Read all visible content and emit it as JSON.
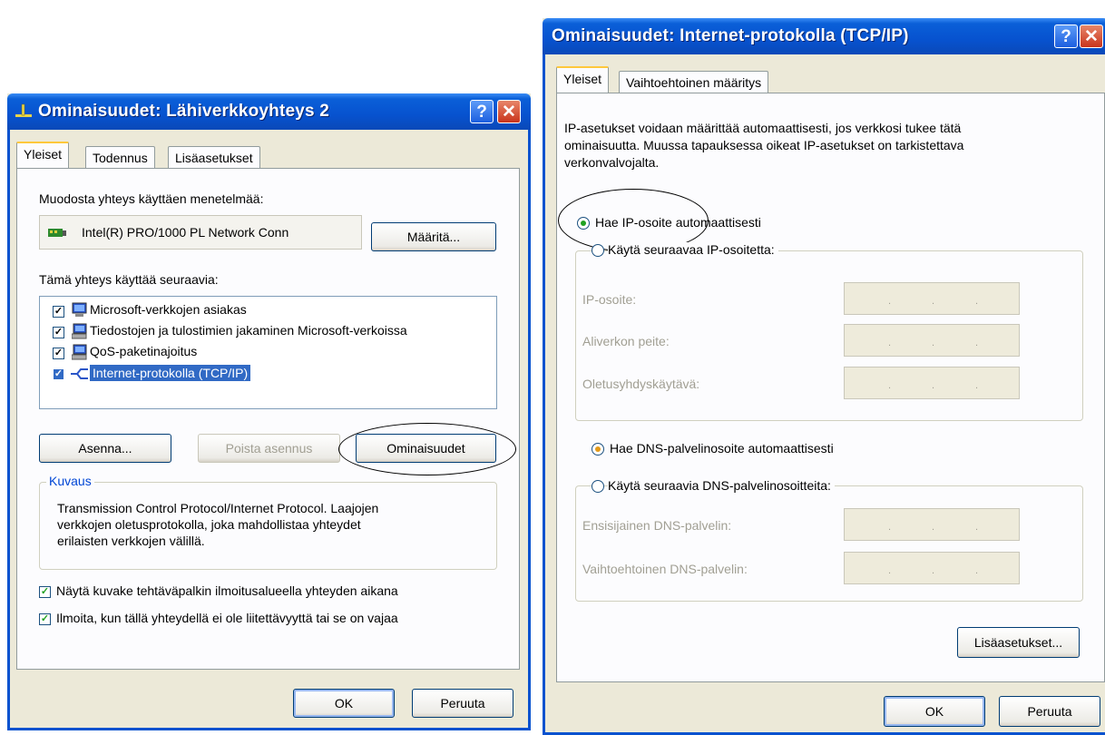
{
  "left_dialog": {
    "title": "Ominaisuudet: Lähiverkkoyhteys 2",
    "help_btn": "?",
    "close_btn": "✕",
    "tabs": [
      "Yleiset",
      "Todennus",
      "Lisäasetukset"
    ],
    "connect_using_label": "Muodosta yhteys käyttäen menetelmää:",
    "adapter_name": "Intel(R) PRO/1000 PL Network Conn",
    "configure_button": "Määritä...",
    "components_label": "Tämä yhteys käyttää seuraavia:",
    "components": [
      {
        "label": "Microsoft-verkkojen asiakas",
        "checked": true
      },
      {
        "label": "Tiedostojen ja tulostimien jakaminen Microsoft-verkoissa",
        "checked": true
      },
      {
        "label": "QoS-paketinajoitus",
        "checked": true
      },
      {
        "label": "Internet-protokolla (TCP/IP)",
        "checked": true,
        "selected": true
      }
    ],
    "install_button": "Asenna...",
    "uninstall_button": "Poista asennus",
    "properties_button": "Ominaisuudet",
    "description_group": "Kuvaus",
    "description_text": [
      "Transmission Control Protocol/Internet Protocol. Laajojen",
      "verkkojen oletusprotokolla, joka mahdollistaa yhteydet",
      "erilaisten verkkojen välillä."
    ],
    "show_icon_label": "Näytä kuvake tehtäväpalkin ilmoitusalueella yhteyden aikana",
    "notify_label": "Ilmoita, kun tällä yhteydellä ei ole liitettävyyttä tai se on vajaa",
    "ok_button": "OK",
    "cancel_button": "Peruuta"
  },
  "right_dialog": {
    "title": "Ominaisuudet: Internet-protokolla (TCP/IP)",
    "help_btn": "?",
    "close_btn": "✕",
    "tabs": [
      "Yleiset",
      "Vaihtoehtoinen määritys"
    ],
    "intro_text": [
      "IP-asetukset voidaan määrittää automaattisesti, jos verkkosi tukee tätä",
      "ominaisuutta. Muussa tapauksessa oikeat IP-asetukset on tarkistettava",
      "verkonvalvojalta."
    ],
    "auto_ip_label": "Hae IP-osoite automaattisesti",
    "manual_ip_label": "Käytä seuraavaa IP-osoitetta:",
    "ip_fields": [
      "IP-osoite:",
      "Aliverkon peite:",
      "Oletusyhdyskäytävä:"
    ],
    "auto_dns_label": "Hae DNS-palvelinosoite automaattisesti",
    "manual_dns_label": "Käytä seuraavia DNS-palvelinosoitteita:",
    "dns_fields": [
      "Ensisijainen DNS-palvelin:",
      "Vaihtoehtoinen DNS-palvelin:"
    ],
    "advanced_button": "Lisäasetukset...",
    "ok_button": "OK",
    "cancel_button": "Peruuta"
  },
  "colors": {
    "titlebar_blue": "#0752cf",
    "dialog_bg": "#ece9d8",
    "selection_blue": "#316ac5",
    "check_green": "#21a121"
  }
}
